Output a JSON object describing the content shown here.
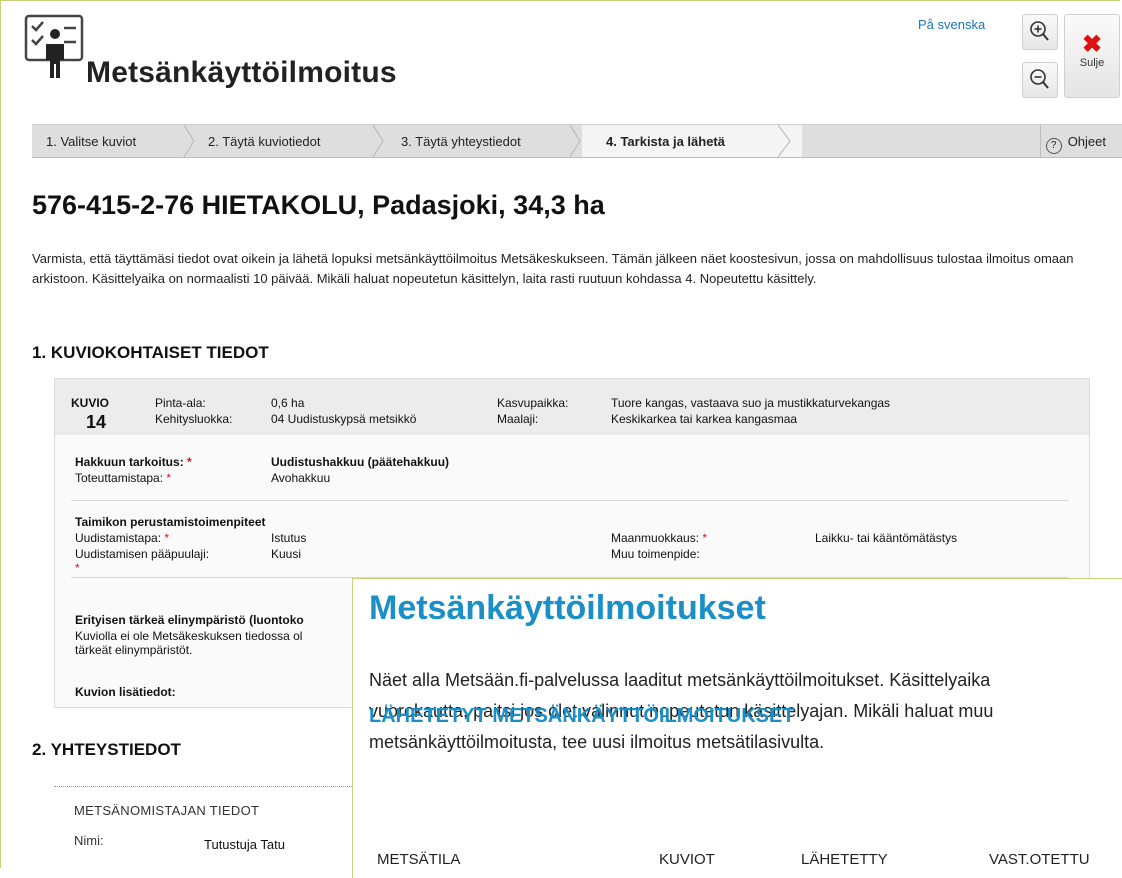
{
  "header": {
    "app_title": "Metsänkäyttöilmoitus",
    "lang_link": "På svenska",
    "close_label": "Sulje"
  },
  "wizard": {
    "steps": [
      {
        "label": "1. Valitse kuviot"
      },
      {
        "label": "2. Täytä kuviotiedot"
      },
      {
        "label": "3. Täytä yhteystiedot"
      },
      {
        "label": "4. Tarkista ja lähetä"
      }
    ],
    "active_step": 4,
    "help_label": "Ohjeet"
  },
  "main": {
    "title": "576-415-2-76 HIETAKOLU, Padasjoki, 34,3 ha",
    "intro": "Varmista, että täyttämäsi tiedot ovat oikein ja lähetä lopuksi metsänkäyttöilmoitus Metsäkeskukseen. Tämän jälkeen näet koostesivun, jossa on mahdollisuus tulostaa ilmoitus omaan arkistoon. Käsittelyaika on normaalisti 10 päivää. Mikäli haluat nopeutetun käsittelyn, laita rasti ruutuun kohdassa 4. Nopeutettu käsittely.",
    "section1_title": "1. KUVIOKOHTAISET TIEDOT",
    "section2_title": "2. YHTEYSTIEDOT"
  },
  "kuvio": {
    "label": "KUVIO",
    "number": "14",
    "pinta_ala_label": "Pinta-ala:",
    "pinta_ala_value": "0,6 ha",
    "kehitysluokka_label": "Kehitysluokka:",
    "kehitysluokka_value": "04 Uudistuskypsä metsikkö",
    "kasvupaikka_label": "Kasvupaikka:",
    "kasvupaikka_value": "Tuore kangas, vastaava suo ja mustikkaturvekangas",
    "maalaji_label": "Maalaji:",
    "maalaji_value": "Keskikarkea tai karkea kangasmaa",
    "hakkuu_label": "Hakkuun tarkoitus:",
    "hakkuu_value": "Uudistushakkuu (päätehakkuu)",
    "toteutus_label": "Toteuttamistapa:",
    "toteutus_value": "Avohakkuu",
    "taimikko_title": "Taimikon perustamistoimenpiteet",
    "uudistamistapa_label": "Uudistamistapa:",
    "uudistamistapa_value": "Istutus",
    "paapuulaji_label": "Uudistamisen pääpuulaji:",
    "paapuulaji_value": "Kuusi",
    "maanmuokkaus_label": "Maanmuokkaus:",
    "maanmuokkaus_value": "Laikku- tai kääntömätästys",
    "muu_label": "Muu toimenpide:",
    "req_mark": "*",
    "erityinen_title": "Erityisen tärkeä elinympäristö (luontoko",
    "erityinen_text1": "Kuviolla ei ole Metsäkeskuksen tiedossa ol",
    "erityinen_text2": "tärkeät elinympäristöt.",
    "lisatiedot_label": "Kuvion lisätiedot:"
  },
  "contact": {
    "title": "METSÄNOMISTAJAN TIEDOT",
    "name_label": "Nimi:",
    "name_value": "Tutustuja Tatu"
  },
  "overlay": {
    "title": "Metsänkäyttöilmoitukset",
    "text_line1": "Näet alla Metsään.fi-palvelussa laaditut metsänkäyttöilmoitukset. Käsittelyaika",
    "text_line2": "vuorokautta, paitsi jos olet valinnut nopeutetun käsittelyajan. Mikäli haluat muu",
    "text_line3": "metsänkäyttöilmoitusta, tee uusi ilmoitus metsätilasivulta.",
    "subtitle": "LÄHETETYT METSÄNKÄYTTÖILMOITUKSET",
    "columns": [
      "METSÄTILA",
      "KUVIOT",
      "LÄHETETTY",
      "VAST.OTETTU"
    ]
  }
}
